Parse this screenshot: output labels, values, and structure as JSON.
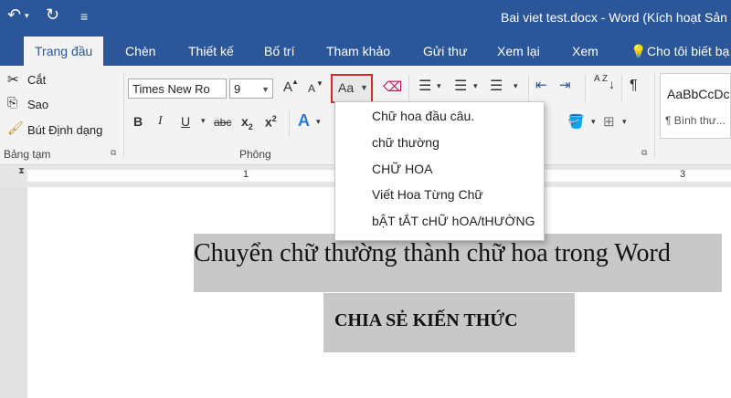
{
  "window": {
    "title": "Bai viet test.docx - Word (Kích hoạt Sản"
  },
  "quick_access": {
    "undo_icon": "undo-icon",
    "redo_icon": "redo-icon",
    "customize_icon": "customize-icon"
  },
  "tabs": [
    {
      "label": "Trang đầu",
      "active": true
    },
    {
      "label": "Chèn"
    },
    {
      "label": "Thiết kế"
    },
    {
      "label": "Bố trí"
    },
    {
      "label": "Tham khảo"
    },
    {
      "label": "Gửi thư"
    },
    {
      "label": "Xem lại"
    },
    {
      "label": "Xem"
    },
    {
      "label": "Cho tôi biết bạ"
    }
  ],
  "clipboard": {
    "cut": "Cắt",
    "copy": "Sao",
    "format_painter": "Bút Định dạng",
    "group_label": "Bảng tạm"
  },
  "font": {
    "name": "Times New Ro",
    "size": "9",
    "grow": "A",
    "shrink": "A",
    "change_case": "Aa",
    "bold": "B",
    "italic": "I",
    "underline": "U",
    "strike": "abc",
    "subscript": "x",
    "subscript_mark": "2",
    "superscript": "x",
    "superscript_mark": "2",
    "text_effects": "A",
    "group_label": "Phông"
  },
  "paragraph": {
    "sort": "A Z",
    "pilcrow": "¶"
  },
  "styles": {
    "preview": "AaBbCcDc",
    "normal_label": "¶ Bình thư..."
  },
  "ruler": {
    "numbers": [
      "1",
      "3"
    ]
  },
  "document": {
    "line1": "Chuyển chữ thường thành chữ hoa trong Word",
    "line2": "CHIA SẺ KIẾN THỨC"
  },
  "change_case_menu": {
    "items": [
      "Chữ hoa đầu câu.",
      "chữ thường",
      "CHỮ HOA",
      "Viết Hoa Từng Chữ",
      "bẬT tẮT cHỮ hOA/tHƯỜNG"
    ]
  },
  "colors": {
    "title_bar": "#2b579a",
    "ribbon": "#f3f3f3",
    "highlight": "#c8c8c8",
    "change_case_outline": "#d9272c"
  }
}
